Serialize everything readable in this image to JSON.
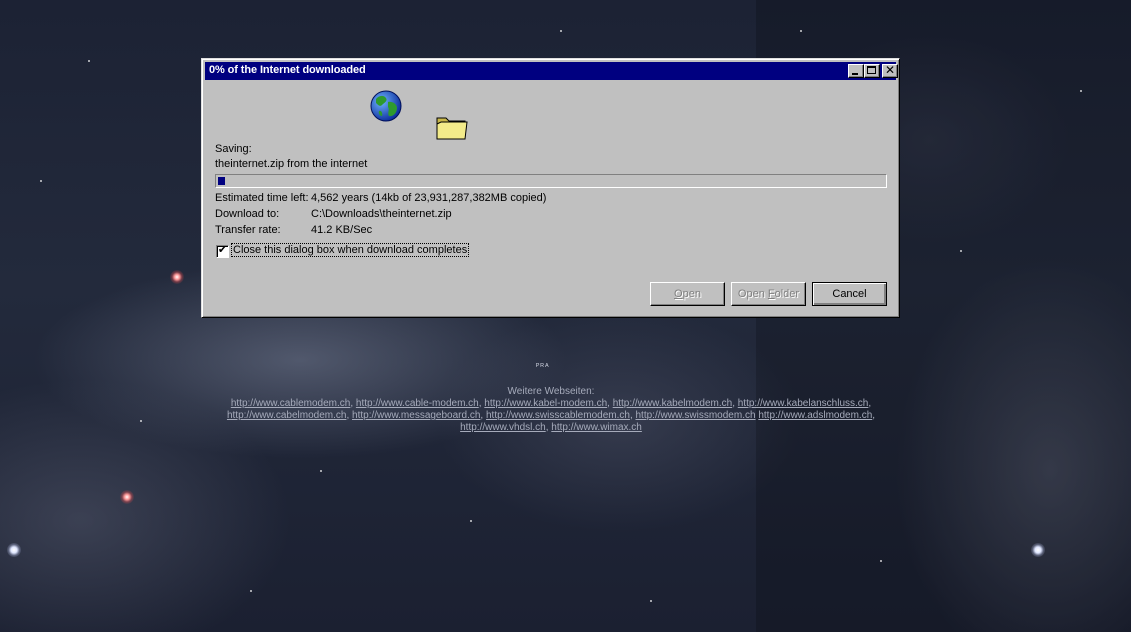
{
  "dialog": {
    "title": "0% of the Internet downloaded",
    "saving_label": "Saving:",
    "file_line": "theinternet.zip from the internet",
    "progress_fraction": 0.01,
    "details": [
      {
        "label": "Estimated time left:",
        "value": "4,562 years (14kb of 23,931,287,382MB copied)"
      },
      {
        "label": "Download to:",
        "value": "C:\\Downloads\\theinternet.zip"
      },
      {
        "label": "Transfer rate:",
        "value": "41.2 KB/Sec"
      }
    ],
    "close_checkbox": {
      "label": "Close this dialog box when download completes",
      "checked": true,
      "mark": "✔"
    },
    "buttons": {
      "open": {
        "prefix": "",
        "underline": "O",
        "suffix": "pen"
      },
      "open_folder": {
        "prefix": "Open ",
        "underline": "F",
        "suffix": "older"
      },
      "cancel": "Cancel"
    },
    "title_buttons": {
      "close_glyph": "✕"
    }
  },
  "footer": {
    "mark": "ᴾᴿᴬ",
    "heading": "Weitere Webseiten:",
    "links": [
      "http://www.cablemodem.ch",
      "http://www.cable-modem.ch",
      "http://www.kabel-modem.ch",
      "http://www.kabelmodem.ch",
      "http://www.kabelanschluss.ch",
      "http://www.cabelmodem.ch",
      "http://www.messageboard.ch",
      "http://www.swisscablemodem.ch",
      "http://www.swissmodem.ch",
      "http://www.adslmodem.ch",
      "http://www.vhdsl.ch",
      "http://www.wimax.ch"
    ]
  },
  "colors": {
    "titlebar": "#000080",
    "dialog_face": "#c0c0c0",
    "progress": "#000080",
    "footer_text": "#a6abbb"
  },
  "icons": [
    "globe-icon",
    "folder-icon",
    "minimize-icon",
    "maximize-icon",
    "close-icon",
    "check-icon"
  ]
}
